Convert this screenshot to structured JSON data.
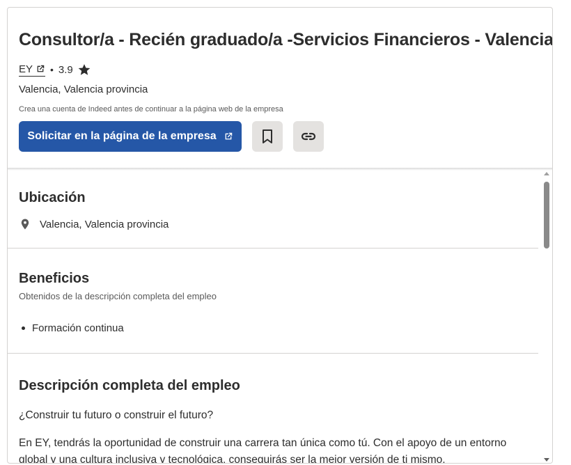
{
  "job": {
    "title": "Consultor/a - Recién graduado/a -Servicios Financieros - Valencia",
    "company": "EY",
    "rating": "3.9",
    "location": "Valencia, Valencia provincia",
    "note": "Crea una cuenta de Indeed antes de continuar a la página web de la empresa"
  },
  "actions": {
    "apply_label": "Solicitar en la página de la empresa",
    "save_icon": "bookmark-icon",
    "copy_icon": "link-icon"
  },
  "sections": {
    "location": {
      "title": "Ubicación",
      "value": "Valencia, Valencia provincia"
    },
    "benefits": {
      "title": "Beneficios",
      "subtitle": "Obtenidos de la descripción completa del empleo",
      "items": [
        "Formación continua"
      ]
    },
    "description": {
      "title": "Descripción completa del empleo",
      "paragraphs": [
        "¿Construir tu futuro o construir el futuro?",
        "En EY, tendrás la oportunidad de construir una carrera tan única como tú. Con el apoyo de un entorno global y una cultura inclusiva y tecnológica, conseguirás ser la mejor versión de ti mismo."
      ]
    }
  },
  "colors": {
    "primary": "#2557a7",
    "text": "#2d2d2d",
    "muted": "#595959",
    "icon_button_bg": "#e4e2e0",
    "divider": "#d4d2d0"
  }
}
